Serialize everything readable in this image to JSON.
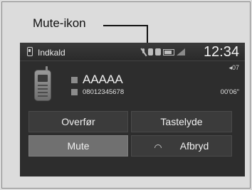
{
  "callout": {
    "label": "Mute-ikon"
  },
  "status_bar": {
    "title": "Indkald",
    "time": "12:34",
    "icons": [
      "mute-icon",
      "bluetooth-icon",
      "bluetooth-icon",
      "battery-icon",
      "signal-icon"
    ]
  },
  "call": {
    "name": "AAAAA",
    "number": "08012345678",
    "volume": "◂07",
    "duration": "00'06\""
  },
  "buttons": {
    "transfer": "Overfør",
    "keypad": "Tastelyde",
    "mute": "Mute",
    "hangup": "Afbryd"
  },
  "colors": {
    "screen_bg": "#2d2d2d",
    "mute_active_bg": "#707070",
    "button_bg": "#3b3b3b"
  }
}
